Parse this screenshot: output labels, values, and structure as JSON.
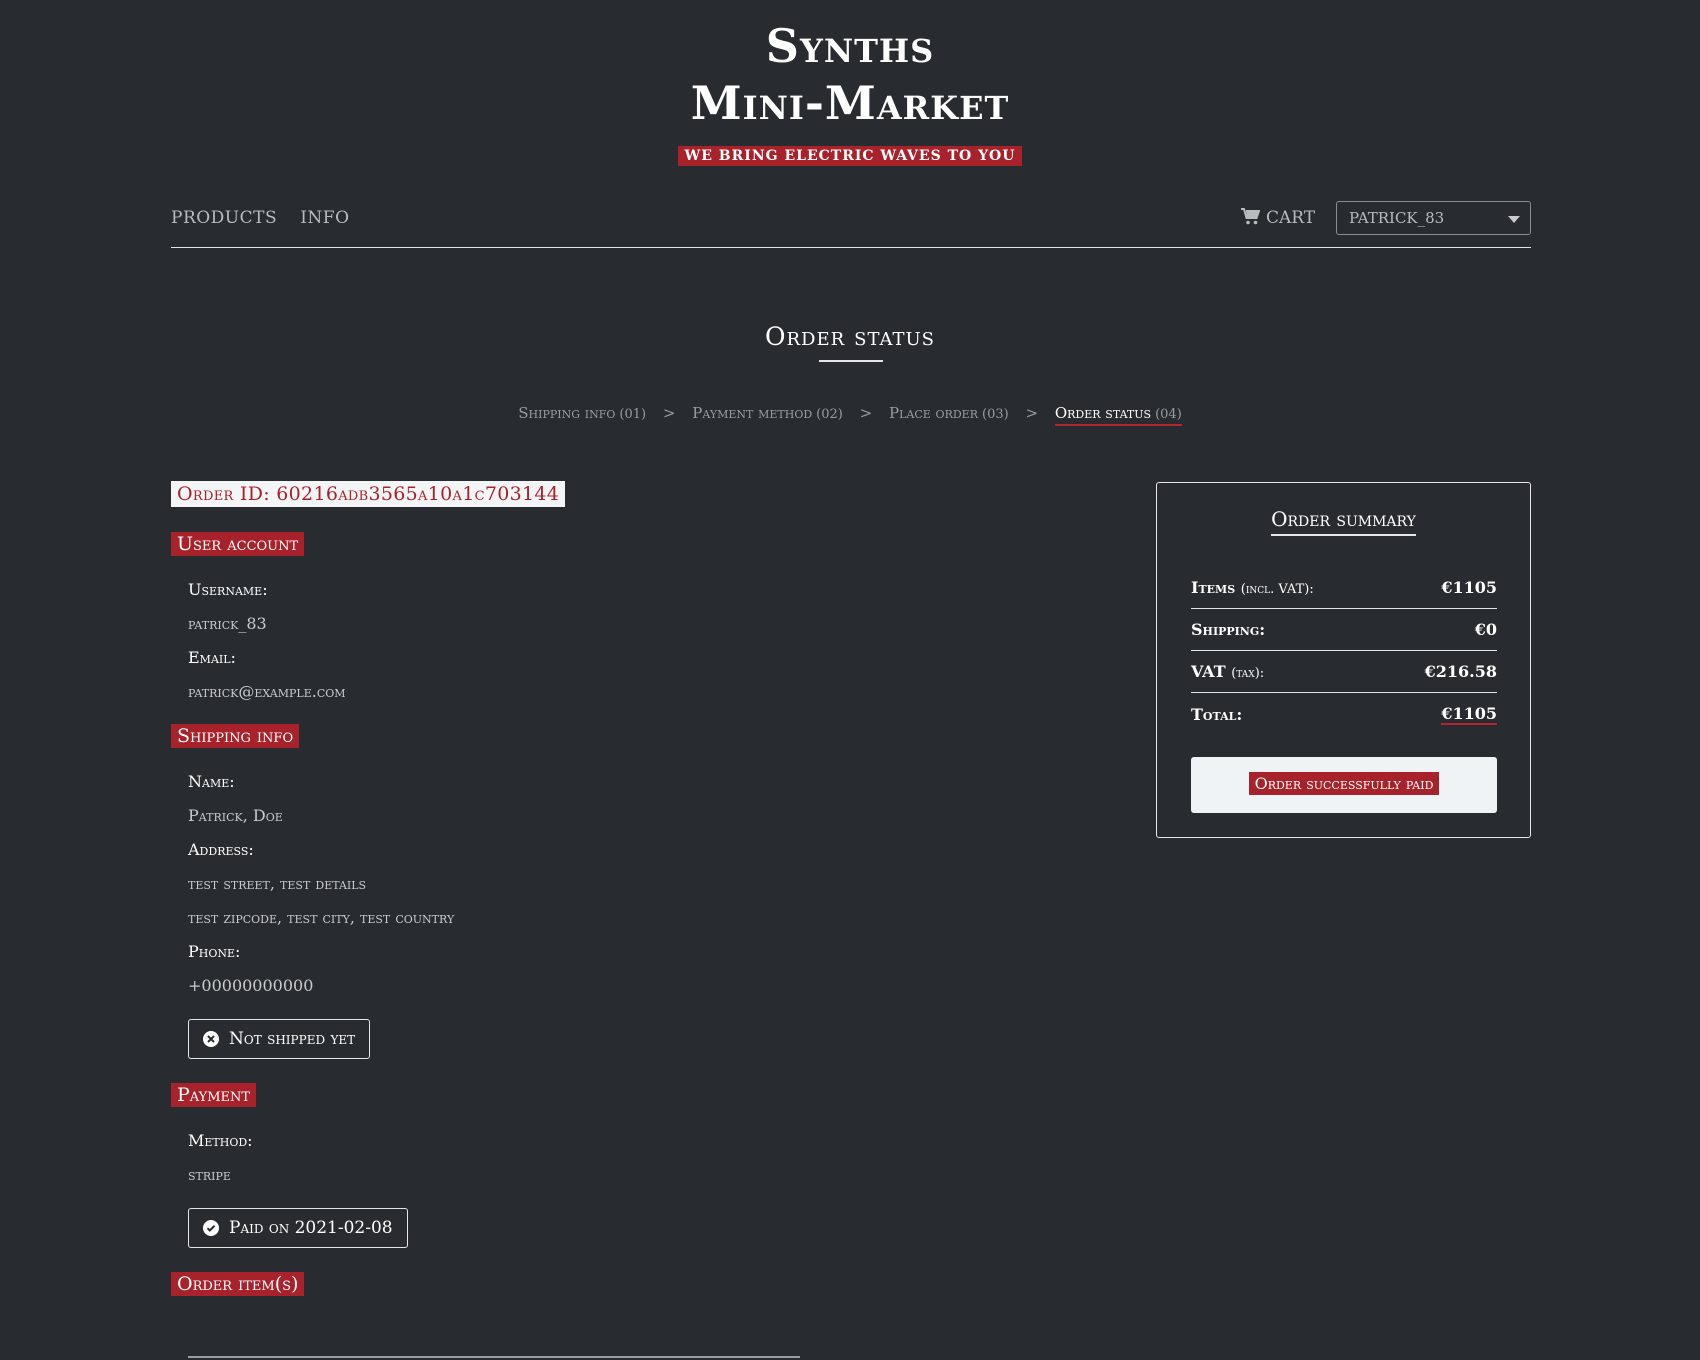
{
  "brand": {
    "title_line1": "Synths",
    "title_line2": "Mini-Market",
    "tagline": "WE BRING ELECTRIC WAVES TO YOU"
  },
  "nav": {
    "links": [
      "PRODUCTS",
      "INFO"
    ],
    "cart_label": "CART",
    "user_selected": "patrick_83"
  },
  "page": {
    "title": "Order status",
    "steps": [
      {
        "label": "Shipping info",
        "num": "(01)"
      },
      {
        "label": "Payment method",
        "num": "(02)"
      },
      {
        "label": "Place order",
        "num": "(03)"
      },
      {
        "label": "Order status",
        "num": "(04)"
      }
    ],
    "step_separator": ">"
  },
  "order": {
    "id_label": "Order ID: 60216adb3565a10a1c703144",
    "user_account": {
      "heading": "User account",
      "username_label": "Username:",
      "username": "patrick_83",
      "email_label": "Email:",
      "email": "patrick@example.com"
    },
    "shipping": {
      "heading": "Shipping info",
      "name_label": "Name:",
      "name": "Patrick, Doe",
      "address_label": "Address:",
      "address_line1": "test street, test details",
      "address_line2": "test zipcode, test city, test country",
      "phone_label": "Phone:",
      "phone": "+00000000000",
      "status": "Not shipped yet"
    },
    "payment": {
      "heading": "Payment",
      "method_label": "Method:",
      "method": "stripe",
      "status": "Paid on 2021-02-08"
    },
    "items": {
      "heading": "Order item(s)"
    }
  },
  "summary": {
    "title": "Order summary",
    "items_label": "Items",
    "items_sub": "(incl. VAT):",
    "items_value": "€1105",
    "shipping_label": "Shipping:",
    "shipping_value": "€0",
    "vat_label": "VAT",
    "vat_sub": "(tax):",
    "vat_value": "€216.58",
    "total_label": "Total:",
    "total_value": "€1105",
    "paid_label": "Order successfully paid"
  },
  "colors": {
    "background": "#282c30",
    "accent": "#a8222c",
    "text": "#ffffff",
    "muted": "#b9bcbf"
  }
}
